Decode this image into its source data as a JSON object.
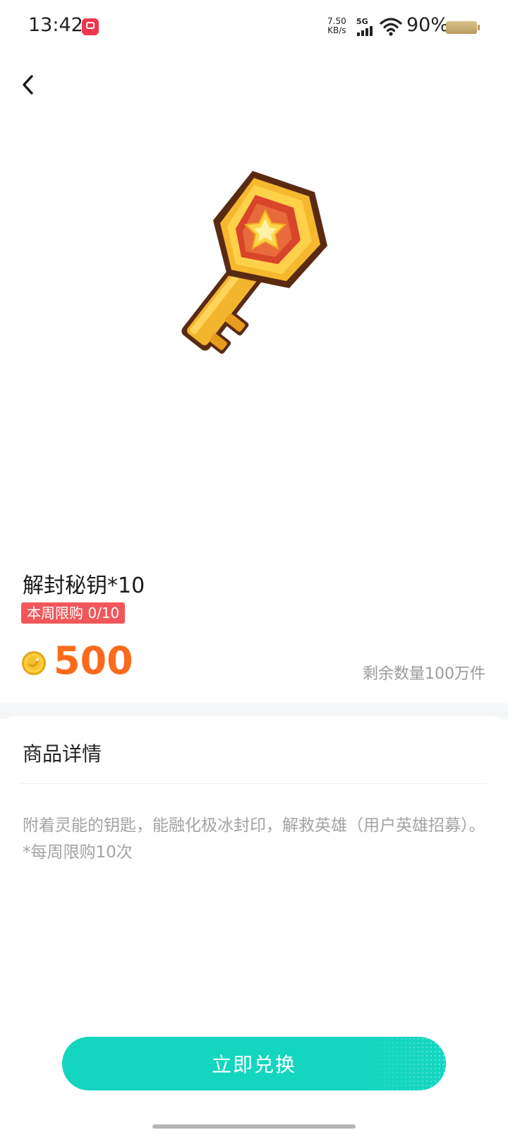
{
  "status_bar": {
    "time": "13:42",
    "net_speed_value": "7.50",
    "net_speed_unit": "KB/s",
    "network": "5G",
    "battery_percent": "90%"
  },
  "product": {
    "title": "解封秘钥*10",
    "limit_badge": "本周限购 0/10",
    "price": "500",
    "stock": "剩余数量100万件",
    "image_icon": "golden-key-icon"
  },
  "detail": {
    "heading": "商品详情",
    "description": "附着灵能的钥匙，能融化极冰封印，解救英雄（用户英雄招募）。",
    "note": "*每周限购10次"
  },
  "action": {
    "redeem_label": "立即兑换"
  },
  "colors": {
    "accent": "#14d6c0",
    "price": "#fa6b1b",
    "badge": "#f1575a"
  }
}
